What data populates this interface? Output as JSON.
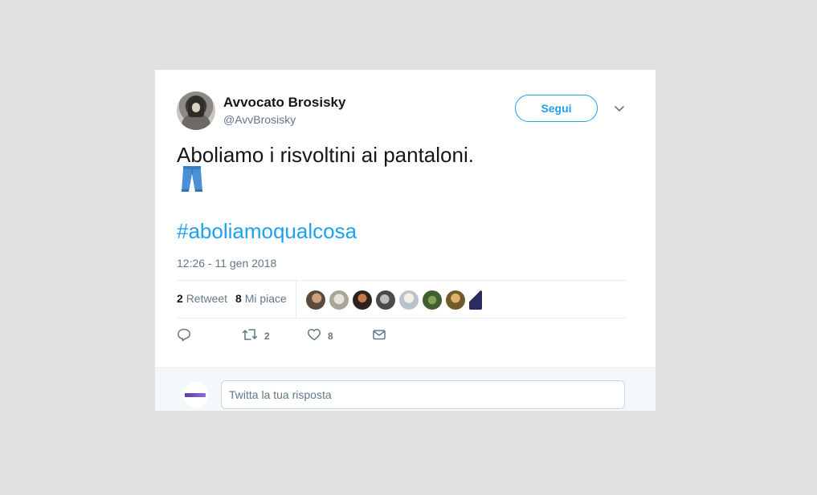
{
  "author": {
    "name": "Avvocato Brosisky",
    "handle": "@AvvBrosisky"
  },
  "follow_button": {
    "label": "Segui"
  },
  "menu": {
    "icon": "chevron-down-icon"
  },
  "tweet": {
    "text": "Aboliamo i risvoltini ai pantaloni.",
    "emoji": "jeans-emoji",
    "hashtag": "#aboliamoqualcosa",
    "timestamp": "12:26 - 11 gen 2018"
  },
  "stats": {
    "retweets_count": "2",
    "retweets_label": "Retweet",
    "likes_count": "8",
    "likes_label": "Mi piace",
    "liker_avatar_count": 8
  },
  "actions": {
    "reply": {
      "icon": "reply-icon"
    },
    "retweet": {
      "icon": "retweet-icon",
      "count": "2"
    },
    "like": {
      "icon": "heart-icon",
      "count": "8"
    },
    "message": {
      "icon": "envelope-icon"
    }
  },
  "reply_box": {
    "placeholder": "Twitta la tua risposta"
  },
  "colors": {
    "accent": "#1da1f2",
    "secondary_text": "#657786",
    "background": "#e1e1e1"
  }
}
